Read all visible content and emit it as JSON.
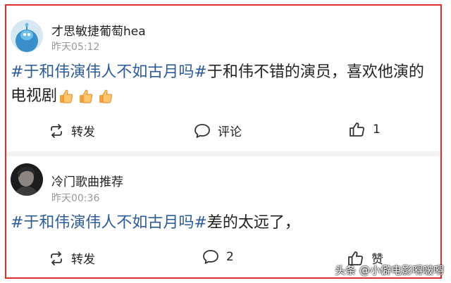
{
  "posts": [
    {
      "username": "才思敏捷葡萄hea",
      "time": "昨天05:12",
      "hashtag": "#于和伟演伟人不如古月吗#",
      "text_line1": "于和伟不错的演员，喜欢他演的",
      "text_line2": "电视剧",
      "emojis": [
        "thumbs-up",
        "thumbs-up",
        "thumbs-up"
      ],
      "actions": {
        "repost": "转发",
        "comment": "评论",
        "like": "1"
      }
    },
    {
      "username": "冷门歌曲推荐",
      "time": "昨天00:36",
      "hashtag": "#于和伟演伟人不如古月吗#",
      "text": "差的太远了，",
      "actions": {
        "repost": "转发",
        "comment": "2",
        "like": "赞"
      }
    }
  ],
  "watermark": "头条 @小僻电影嘚啵嘚",
  "colors": {
    "border": "#e02c2c",
    "hashtag": "#2e5b9a",
    "meta": "#999999"
  }
}
